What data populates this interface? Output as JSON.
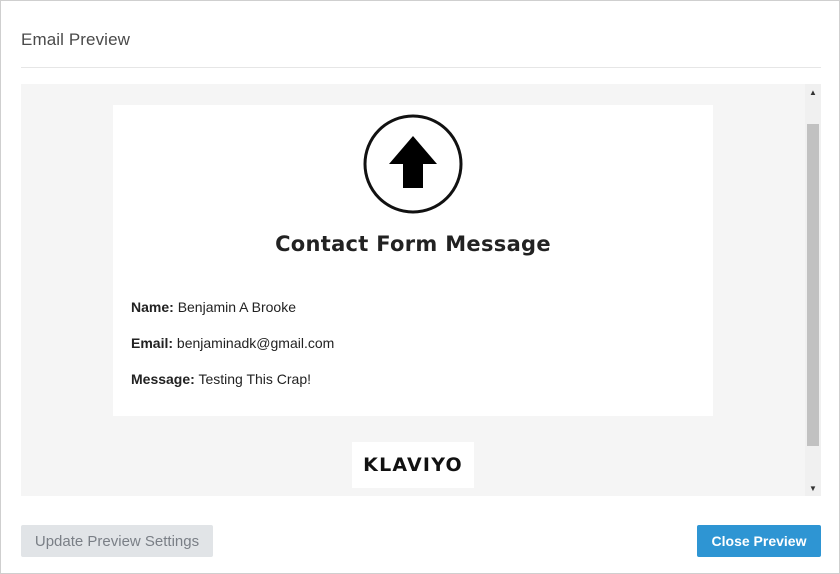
{
  "modal": {
    "title": "Email Preview"
  },
  "email": {
    "heading": "Contact Form Message",
    "fields": [
      {
        "label": "Name:",
        "value": "Benjamin A Brooke"
      },
      {
        "label": "Email:",
        "value": "benjaminadk@gmail.com"
      },
      {
        "label": "Message:",
        "value": "Testing This Crap!"
      }
    ],
    "logo_icon": "up-arrow-circle-icon",
    "footer_brand": "KLAVIYO"
  },
  "scrollbar": {
    "up_icon": "▲",
    "down_icon": "▼"
  },
  "buttons": {
    "update_label": "Update Preview Settings",
    "close_label": "Close Preview"
  },
  "colors": {
    "primary": "#2e95d3",
    "secondary_button": "#e1e4e7",
    "preview_background": "#f5f5f5"
  }
}
